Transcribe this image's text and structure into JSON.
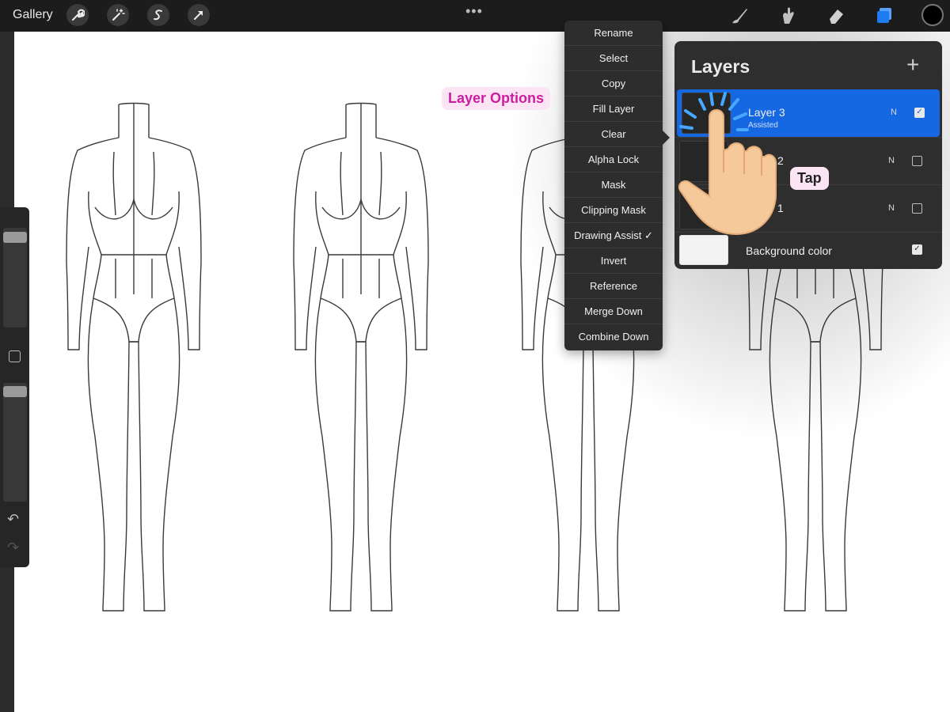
{
  "toolbar": {
    "gallery_label": "Gallery",
    "left_tools": [
      {
        "name": "wrench-icon"
      },
      {
        "name": "magic-wand-icon"
      },
      {
        "name": "selection-icon"
      },
      {
        "name": "transform-arrow-icon"
      }
    ],
    "more_label": "•••",
    "right_tools": [
      {
        "name": "brush-icon"
      },
      {
        "name": "smudge-icon"
      },
      {
        "name": "eraser-icon"
      },
      {
        "name": "layers-icon"
      }
    ],
    "active_tool_color": "#1e7bf0",
    "current_color": "#000000"
  },
  "sidebar": {
    "undo_icon": "↶",
    "redo_icon": "↷"
  },
  "annotations": {
    "options_label": "Layer Options",
    "tap_label": "Tap",
    "accent_color": "#cc1d9f"
  },
  "menu": {
    "items": [
      "Rename",
      "Select",
      "Copy",
      "Fill Layer",
      "Clear",
      "Alpha Lock",
      "Mask",
      "Clipping Mask",
      "Drawing Assist ✓",
      "Invert",
      "Reference",
      "Merge Down",
      "Combine Down"
    ]
  },
  "layers": {
    "title": "Layers",
    "add_icon": "+",
    "rows": [
      {
        "name": "Layer 3",
        "subtitle": "Assisted",
        "blend": "N",
        "visible": true,
        "active": true
      },
      {
        "name": "2",
        "subtitle": "",
        "blend": "N",
        "visible": false,
        "active": false
      },
      {
        "name": "1",
        "subtitle": "",
        "blend": "N",
        "visible": false,
        "active": false
      },
      {
        "name": "Background color",
        "subtitle": "",
        "blend": "",
        "visible": true,
        "active": false
      }
    ],
    "active_color": "#1667e2"
  }
}
